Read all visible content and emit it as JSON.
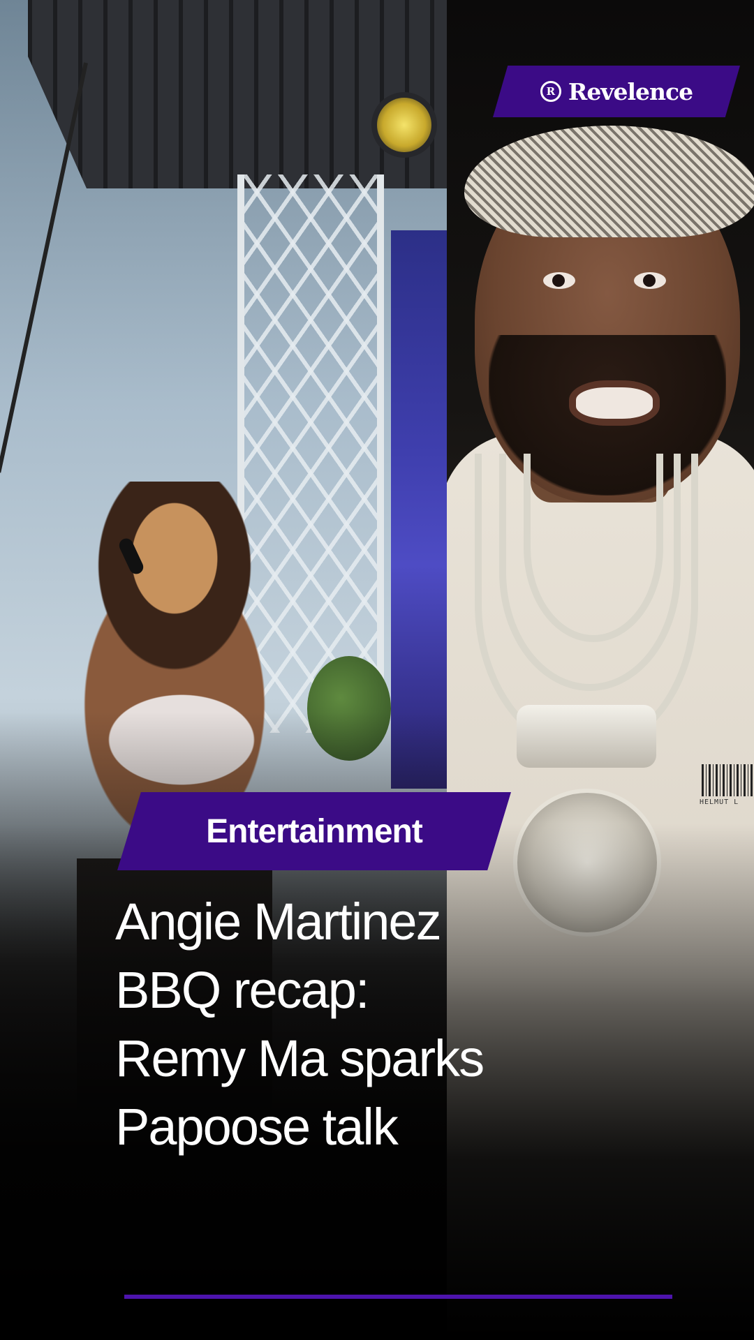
{
  "brand": {
    "logo_glyph": "R",
    "name": "Revelence",
    "color": "#3b0b86"
  },
  "story": {
    "category": "Entertainment",
    "headline_lines": [
      "Angie Martinez",
      "BBQ recap:",
      "Remy Ma sparks",
      "Papoose talk"
    ]
  },
  "images": {
    "left": "photo of a performer singing into a microphone on an outdoor concert stage",
    "right": "portrait photo of a man wearing a knit headband and chain necklaces"
  },
  "barcode_text": "HELMUT L",
  "progress": {
    "value_percent": 100,
    "color": "#4d14ad"
  }
}
